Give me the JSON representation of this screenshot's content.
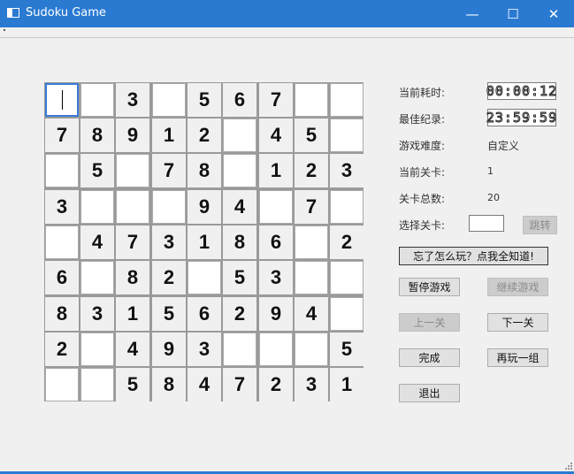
{
  "window": {
    "title": "Sudoku Game",
    "minimize_glyph": "—",
    "maximize_glyph": "☐",
    "close_glyph": "✕"
  },
  "board": {
    "rows": [
      [
        "",
        "",
        "3",
        "",
        "5",
        "6",
        "7",
        "",
        ""
      ],
      [
        "7",
        "8",
        "9",
        "1",
        "2",
        "",
        "4",
        "5",
        ""
      ],
      [
        "",
        "5",
        "",
        "7",
        "8",
        "",
        "1",
        "2",
        "3"
      ],
      [
        "3",
        "",
        "",
        "",
        "9",
        "4",
        "",
        "7",
        ""
      ],
      [
        "",
        "4",
        "7",
        "3",
        "1",
        "8",
        "6",
        "",
        "2"
      ],
      [
        "6",
        "",
        "8",
        "2",
        "",
        "5",
        "3",
        "",
        ""
      ],
      [
        "8",
        "3",
        "1",
        "5",
        "6",
        "2",
        "9",
        "4",
        ""
      ],
      [
        "2",
        "",
        "4",
        "9",
        "3",
        "",
        "",
        "",
        "5"
      ],
      [
        "",
        "",
        "5",
        "8",
        "4",
        "7",
        "2",
        "3",
        "1"
      ]
    ],
    "selected": [
      0,
      0
    ]
  },
  "panel": {
    "current_time_label": "当前耗时:",
    "current_time_value": "00:00:12",
    "best_record_label": "最佳纪录:",
    "best_record_value": "23:59:59",
    "difficulty_label": "游戏难度:",
    "difficulty_value": "自定义",
    "current_level_label": "当前关卡:",
    "current_level_value": "1",
    "total_levels_label": "关卡总数:",
    "total_levels_value": "20",
    "select_level_label": "选择关卡:",
    "select_level_value": "",
    "jump_button": "跳转",
    "help_button": "忘了怎么玩？点我全知道!",
    "pause_button": "暂停游戏",
    "resume_button": "继续游戏",
    "prev_button": "上一关",
    "next_button": "下一关",
    "finish_button": "完成",
    "replay_button": "再玩一组",
    "exit_button": "退出"
  }
}
